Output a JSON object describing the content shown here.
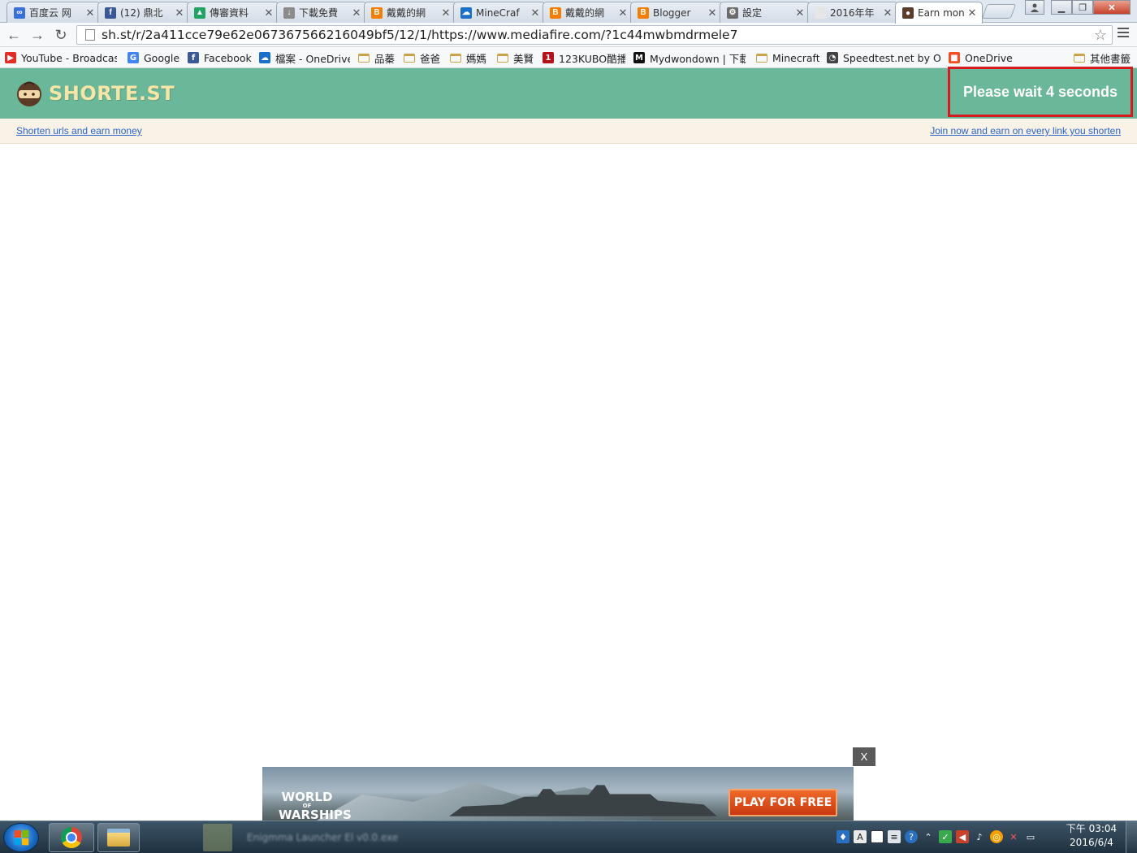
{
  "browser": {
    "tabs": [
      {
        "label": "百度云 网",
        "favicon_color": "#3b6fd8",
        "favicon": "∞"
      },
      {
        "label": "(12) 鼎北",
        "favicon_color": "#3b5998",
        "favicon": "f"
      },
      {
        "label": "傳審資料",
        "favicon_color": "#1fa463",
        "favicon": "▲"
      },
      {
        "label": "下載免費",
        "favicon_color": "#8b8b8b",
        "favicon": "↓"
      },
      {
        "label": "戴戴的網",
        "favicon_color": "#f57d00",
        "favicon": "B"
      },
      {
        "label": "MineCraf",
        "favicon_color": "#1a6fc9",
        "favicon": "☁"
      },
      {
        "label": "戴戴的網",
        "favicon_color": "#f57d00",
        "favicon": "B"
      },
      {
        "label": "Blogger",
        "favicon_color": "#f57d00",
        "favicon": "B"
      },
      {
        "label": "設定",
        "favicon_color": "#6b6b6b",
        "favicon": "⚙"
      },
      {
        "label": "2016年年",
        "favicon_color": "#e6e6e6",
        "favicon": ""
      },
      {
        "label": "Earn mon",
        "favicon_color": "#5a3d2b",
        "favicon": "●"
      }
    ],
    "url": "sh.st/r/2a411cce79e62e067367566216049bf5/12/1/https://www.mediafire.com/?1c44mwbmdrmele7",
    "bookmarks": [
      {
        "label": "YouTube - Broadcast",
        "icon": "youtube-icon",
        "color": "#e52d27",
        "glyph": "▶"
      },
      {
        "label": "Google",
        "icon": "google-icon",
        "color": "#4285f4",
        "glyph": "G"
      },
      {
        "label": "Facebook",
        "icon": "facebook-icon",
        "color": "#3b5998",
        "glyph": "f"
      },
      {
        "label": "檔案 - OneDrive",
        "icon": "onedrive-icon",
        "color": "#1a6fc9",
        "glyph": "☁"
      },
      {
        "label": "品蓁",
        "icon": "folder-icon",
        "color": "",
        "glyph": ""
      },
      {
        "label": "爸爸",
        "icon": "folder-icon",
        "color": "",
        "glyph": ""
      },
      {
        "label": "媽媽",
        "icon": "folder-icon",
        "color": "",
        "glyph": ""
      },
      {
        "label": "美賢",
        "icon": "folder-icon",
        "color": "",
        "glyph": ""
      },
      {
        "label": "123KUBO酷播",
        "icon": "kubo-icon",
        "color": "#b5121b",
        "glyph": "1"
      },
      {
        "label": "Mydwondown | 下載",
        "icon": "m-logo-icon",
        "color": "#111111",
        "glyph": "M"
      },
      {
        "label": "Minecraft",
        "icon": "folder-icon",
        "color": "",
        "glyph": ""
      },
      {
        "label": "Speedtest.net by Ookla",
        "icon": "speedometer-icon",
        "color": "#444444",
        "glyph": "◔"
      },
      {
        "label": "OneDrive",
        "icon": "windows-icon",
        "color": "#f25022",
        "glyph": "■"
      }
    ],
    "other_bookmarks": "其他書籤"
  },
  "site": {
    "logo": "SHORTE.ST",
    "wait_message": "Please wait 4 seconds",
    "left_link": "Shorten urls and earn money",
    "right_link": "Join now and earn on every link you shorten",
    "header_color": "#6ab79a",
    "logo_color": "#f5e6a8",
    "highlight_color": "#d71920"
  },
  "ad": {
    "close_label": "X",
    "brand_line1": "WORLD",
    "brand_line2": "OF",
    "brand_line3": "WARSHIPS",
    "cta": "PLAY FOR FREE"
  },
  "taskbar": {
    "clock_time": "下午 03:04",
    "clock_date": "2016/6/4",
    "ghost_window_text": "Enigmma Launcher El v0.0.exe"
  }
}
